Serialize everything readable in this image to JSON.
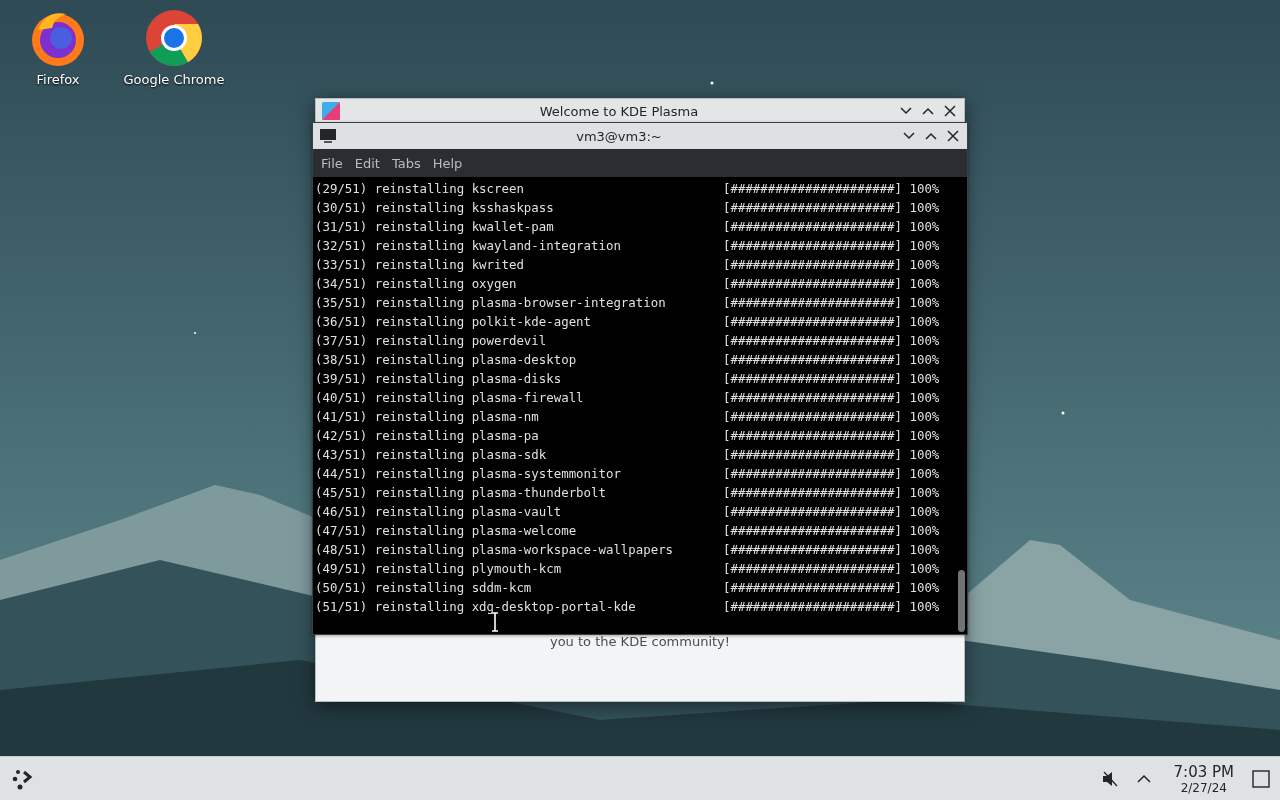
{
  "desktop_icons": [
    {
      "label": "Firefox",
      "kind": "firefox"
    },
    {
      "label": "Google Chrome",
      "kind": "chrome"
    }
  ],
  "welcome_window": {
    "title": "Welcome to KDE Plasma",
    "body_text": "you to the KDE community!"
  },
  "terminal_window": {
    "title": "vm3@vm3:~",
    "menu": [
      "File",
      "Edit",
      "Tabs",
      "Help"
    ],
    "lines": [
      {
        "text": "(29/51) reinstalling kscreen",
        "progress": "[######################] 100%"
      },
      {
        "text": "(30/51) reinstalling ksshaskpass",
        "progress": "[######################] 100%"
      },
      {
        "text": "(31/51) reinstalling kwallet-pam",
        "progress": "[######################] 100%"
      },
      {
        "text": "(32/51) reinstalling kwayland-integration",
        "progress": "[######################] 100%"
      },
      {
        "text": "(33/51) reinstalling kwrited",
        "progress": "[######################] 100%"
      },
      {
        "text": "(34/51) reinstalling oxygen",
        "progress": "[######################] 100%"
      },
      {
        "text": "(35/51) reinstalling plasma-browser-integration",
        "progress": "[######################] 100%"
      },
      {
        "text": "(36/51) reinstalling polkit-kde-agent",
        "progress": "[######################] 100%"
      },
      {
        "text": "(37/51) reinstalling powerdevil",
        "progress": "[######################] 100%"
      },
      {
        "text": "(38/51) reinstalling plasma-desktop",
        "progress": "[######################] 100%"
      },
      {
        "text": "(39/51) reinstalling plasma-disks",
        "progress": "[######################] 100%"
      },
      {
        "text": "(40/51) reinstalling plasma-firewall",
        "progress": "[######################] 100%"
      },
      {
        "text": "(41/51) reinstalling plasma-nm",
        "progress": "[######################] 100%"
      },
      {
        "text": "(42/51) reinstalling plasma-pa",
        "progress": "[######################] 100%"
      },
      {
        "text": "(43/51) reinstalling plasma-sdk",
        "progress": "[######################] 100%"
      },
      {
        "text": "(44/51) reinstalling plasma-systemmonitor",
        "progress": "[######################] 100%"
      },
      {
        "text": "(45/51) reinstalling plasma-thunderbolt",
        "progress": "[######################] 100%"
      },
      {
        "text": "(46/51) reinstalling plasma-vault",
        "progress": "[######################] 100%"
      },
      {
        "text": "(47/51) reinstalling plasma-welcome",
        "progress": "[######################] 100%"
      },
      {
        "text": "(48/51) reinstalling plasma-workspace-wallpapers",
        "progress": "[######################] 100%"
      },
      {
        "text": "(49/51) reinstalling plymouth-kcm",
        "progress": "[######################] 100%"
      },
      {
        "text": "(50/51) reinstalling sddm-kcm",
        "progress": "[######################] 100%"
      },
      {
        "text": "(51/51) reinstalling xdg-desktop-portal-kde",
        "progress": "[######################] 100%"
      }
    ]
  },
  "taskbar": {
    "time": "7:03 PM",
    "date": "2/27/24"
  }
}
